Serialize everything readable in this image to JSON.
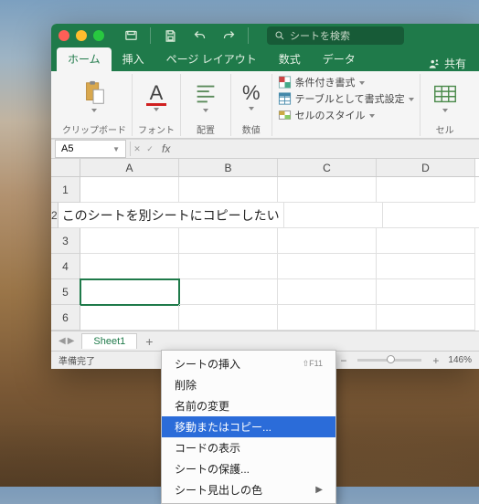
{
  "titlebar": {
    "search_placeholder": "シートを検索"
  },
  "tabs": {
    "home": "ホーム",
    "insert": "挿入",
    "page_layout": "ページ レイアウト",
    "formulas": "数式",
    "data": "データ",
    "share": "共有"
  },
  "ribbon": {
    "clipboard": "クリップボード",
    "font": "フォント",
    "alignment": "配置",
    "number": "数値",
    "conditional_formatting": "条件付き書式",
    "format_as_table": "テーブルとして書式設定",
    "cell_styles": "セルのスタイル",
    "cells": "セル",
    "font_letter": "A",
    "percent": "%"
  },
  "fxbar": {
    "cell_ref": "A5",
    "fx_label": "fx"
  },
  "grid": {
    "columns": [
      "A",
      "B",
      "C",
      "D"
    ],
    "row_numbers": [
      "1",
      "2",
      "3",
      "4",
      "5",
      "6"
    ],
    "a2_text": "このシートを別シートにコピーしたい"
  },
  "sheetbar": {
    "sheet1": "Sheet1",
    "add": "+"
  },
  "status": {
    "ready": "準備完了",
    "zoom_minus": "−",
    "zoom_plus": "+",
    "zoom_pct": "146%"
  },
  "context_menu": {
    "insert_sheet": "シートの挿入",
    "insert_sheet_key": "⇧F11",
    "delete": "削除",
    "rename": "名前の変更",
    "move_or_copy": "移動またはコピー...",
    "view_code": "コードの表示",
    "protect_sheet": "シートの保護...",
    "tab_color": "シート見出しの色"
  }
}
